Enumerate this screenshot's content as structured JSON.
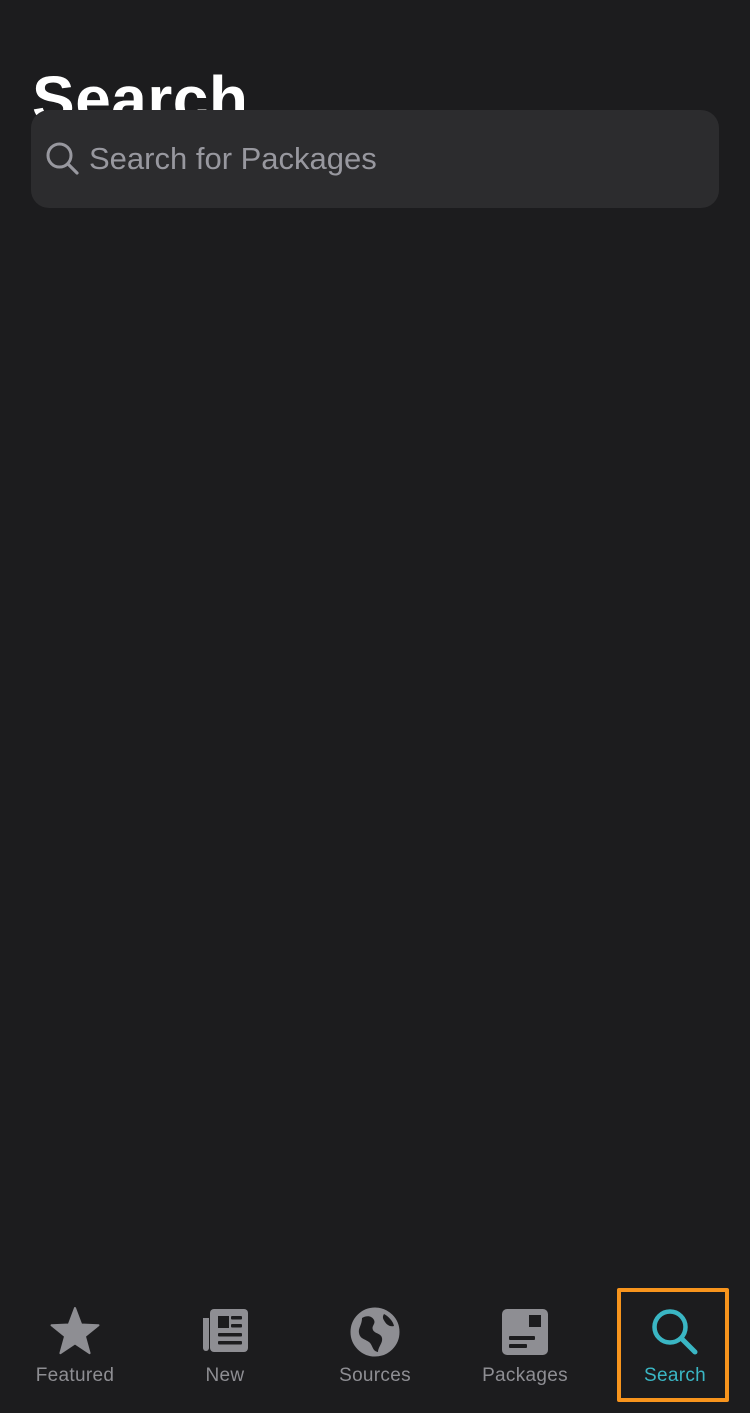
{
  "header": {
    "title": "Search"
  },
  "search": {
    "placeholder": "Search for Packages",
    "value": "",
    "icon": "magnifying-glass-icon"
  },
  "tab_bar": {
    "active": "Search",
    "accent_color": "#3ab6c4",
    "highlight_color": "#f7941d",
    "tabs": [
      {
        "label": "Featured",
        "icon": "star-icon"
      },
      {
        "label": "New",
        "icon": "newspaper-icon"
      },
      {
        "label": "Sources",
        "icon": "globe-icon"
      },
      {
        "label": "Packages",
        "icon": "package-icon"
      },
      {
        "label": "Search",
        "icon": "magnifying-glass-icon"
      }
    ]
  }
}
